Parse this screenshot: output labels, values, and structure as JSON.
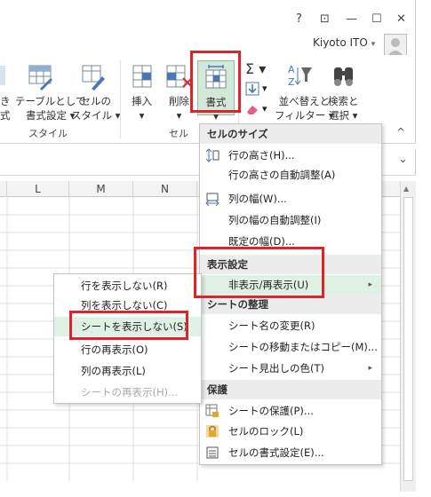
{
  "window": {
    "help": "?",
    "ribbon_display": "⊡",
    "minimize": "—",
    "maximize": "☐",
    "close": "✕",
    "user": "Kiyoto ITO",
    "user_dropdown": "▾"
  },
  "ribbon": {
    "style_group": {
      "partial_label": "き\n式",
      "table_format": "テーブルとして\n書式設定 ▾",
      "cell_style": "セルの\nスタイル ▾",
      "group_label": "スタイル"
    },
    "cells_group": {
      "insert": "挿入\n▾",
      "delete": "削除\n▾",
      "format": "書式\n▾",
      "group_label": "セル"
    },
    "editing_group": {
      "autosum": "Σ ▾",
      "fill": "▾",
      "clear": "▾",
      "sort_filter": "並べ替えと\nフィルター ▾",
      "find_select": "検索と\n選択 ▾"
    },
    "collapse": "^"
  },
  "formula_bar": {
    "expand": "⌄"
  },
  "grid": {
    "columns": [
      "L",
      "M",
      "N"
    ]
  },
  "format_menu": {
    "sections": [
      {
        "header": "セルのサイズ",
        "items": [
          {
            "label": "行の高さ(H)...",
            "icon": "row-height-icon"
          },
          {
            "label": "行の高さの自動調整(A)",
            "icon": ""
          },
          {
            "label": "列の幅(W)...",
            "icon": "column-width-icon"
          },
          {
            "label": "列の幅の自動調整(I)",
            "icon": ""
          },
          {
            "label": "既定の幅(D)...",
            "icon": ""
          }
        ]
      },
      {
        "header": "表示設定",
        "items": [
          {
            "label": "非表示/再表示(U)",
            "icon": "",
            "submenu": "▸"
          }
        ]
      },
      {
        "header": "シートの整理",
        "items": [
          {
            "label": "シート名の変更(R)",
            "icon": ""
          },
          {
            "label": "シートの移動またはコピー(M)...",
            "icon": ""
          },
          {
            "label": "シート見出しの色(T)",
            "icon": "",
            "submenu": "▸"
          }
        ]
      },
      {
        "header": "保護",
        "items": [
          {
            "label": "シートの保護(P)...",
            "icon": "protect-sheet-icon"
          },
          {
            "label": "セルのロック(L)",
            "icon": "lock-icon"
          },
          {
            "label": "セルの書式設定(E)...",
            "icon": "format-cells-icon"
          }
        ]
      }
    ]
  },
  "hide_submenu": {
    "items": [
      {
        "label": "行を表示しない(R)"
      },
      {
        "label": "列を表示しない(C)"
      },
      {
        "label": "シートを表示しない(S)"
      },
      {
        "label": "行の再表示(O)"
      },
      {
        "label": "列の再表示(L)"
      },
      {
        "label": "シートの再表示(H)..."
      }
    ]
  },
  "colors": {
    "accent_green": "#217346",
    "highlight": "#dff0e4",
    "annotation_red": "#d9262c"
  }
}
